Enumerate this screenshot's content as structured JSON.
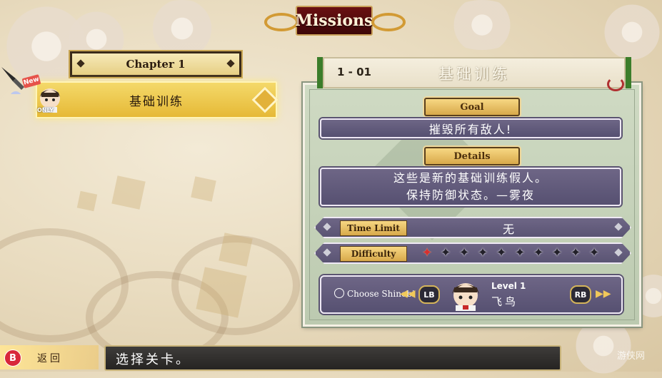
{
  "header": {
    "title": "Missions"
  },
  "chapter": {
    "label": "Chapter 1"
  },
  "mission_list": {
    "items": [
      {
        "label": "基础训练",
        "badge_new": "New",
        "badge_only": "ONLY",
        "selected": true
      }
    ]
  },
  "mission_detail": {
    "number": "1 - 01",
    "name": "基础训练",
    "goal_label": "Goal",
    "goal_text": "摧毁所有敌人!",
    "details_label": "Details",
    "details_line1": "这些是新的基础训练假人。",
    "details_line2": "保持防御状态。—雾夜",
    "time_limit_label": "Time Limit",
    "time_limit_value": "无",
    "difficulty_label": "Difficulty",
    "difficulty_total": 10,
    "difficulty_value": 1
  },
  "shinobi": {
    "choose_label": "Choose Shinobi",
    "lb_label": "LB",
    "rb_label": "RB",
    "level_label": "Level 1",
    "character_name": "飞鸟"
  },
  "footer": {
    "back_button": "B",
    "back_label": "返回",
    "hint": "选择关卡。",
    "watermark": "游侠网"
  },
  "colors": {
    "title_bg": "#5a0c0e",
    "selected_row": "#eac54a",
    "panel_bg": "#c6d2ba",
    "purple_bar": "#625b7c",
    "gold_tag": "#e6bd62"
  }
}
